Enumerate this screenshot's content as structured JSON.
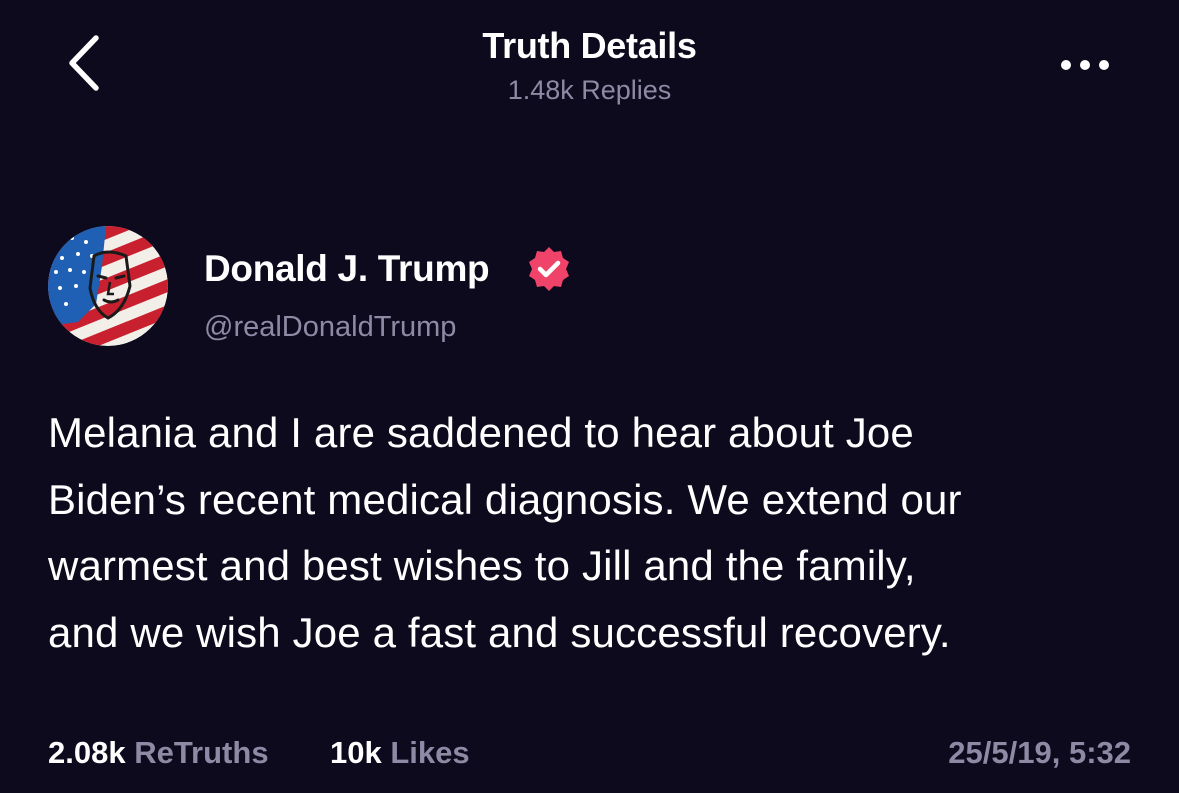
{
  "header": {
    "title": "Truth Details",
    "subtitle": "1.48k Replies",
    "back_icon": "chevron-left-icon",
    "more_icon": "more-horizontal-icon"
  },
  "post": {
    "author": {
      "name": "Donald J. Trump",
      "handle": "@realDonaldTrump",
      "verified": true,
      "verified_icon": "verified-badge-icon",
      "verified_color": "#f0436a"
    },
    "text": "Melania and I are saddened to hear about Joe\nBiden’s recent medical diagnosis. We extend our\nwarmest and best wishes to Jill and the family,\nand we wish Joe a fast and successful recovery.",
    "stats": {
      "retruths_count": "2.08k",
      "retruths_label": "ReTruths",
      "likes_count": "10k",
      "likes_label": "Likes"
    },
    "timestamp": "25/5/19, 5:32"
  },
  "colors": {
    "background": "#0c0a1c",
    "primary_text": "#ffffff",
    "secondary_text": "#8e8aa5",
    "accent": "#f0436a"
  }
}
